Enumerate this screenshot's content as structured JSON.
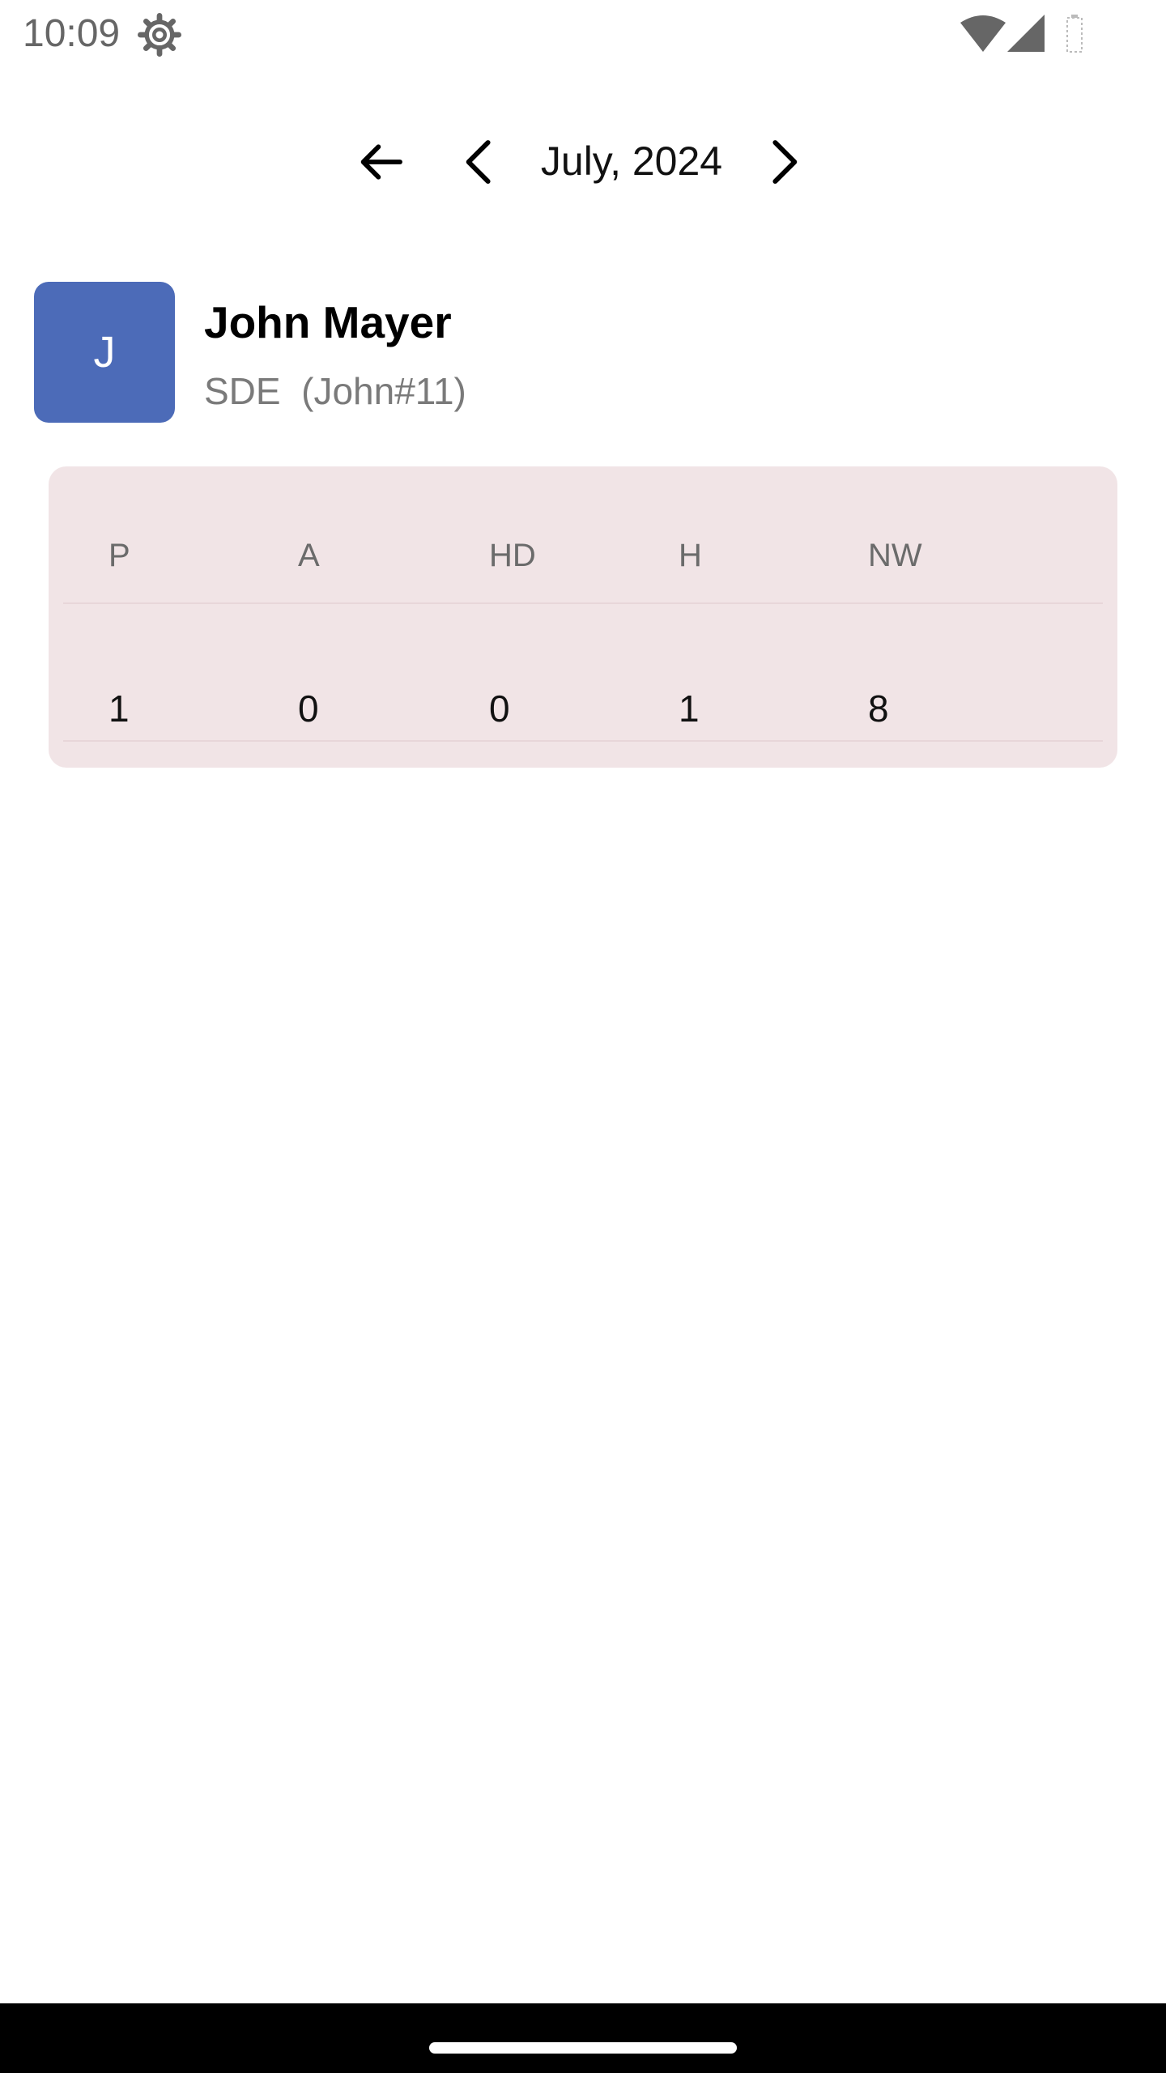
{
  "status": {
    "time": "10:09"
  },
  "month_nav": {
    "label": "July, 2024"
  },
  "employee": {
    "initial": "J",
    "name": "John Mayer",
    "subtitle": "SDE  (John#11)"
  },
  "summary": {
    "headers": [
      "P",
      "A",
      "HD",
      "H",
      "NW"
    ],
    "values": [
      "1",
      "0",
      "0",
      "1",
      "8"
    ]
  },
  "colors": {
    "avatar_bg": "#4C6BB8",
    "card_bg": "#F1E4E6"
  },
  "icons": {
    "back": "arrow-left-icon",
    "prev": "chevron-left-icon",
    "next": "chevron-right-icon",
    "settings": "gear-icon",
    "wifi": "wifi-icon",
    "signal": "cellular-signal-icon",
    "battery": "battery-icon"
  }
}
